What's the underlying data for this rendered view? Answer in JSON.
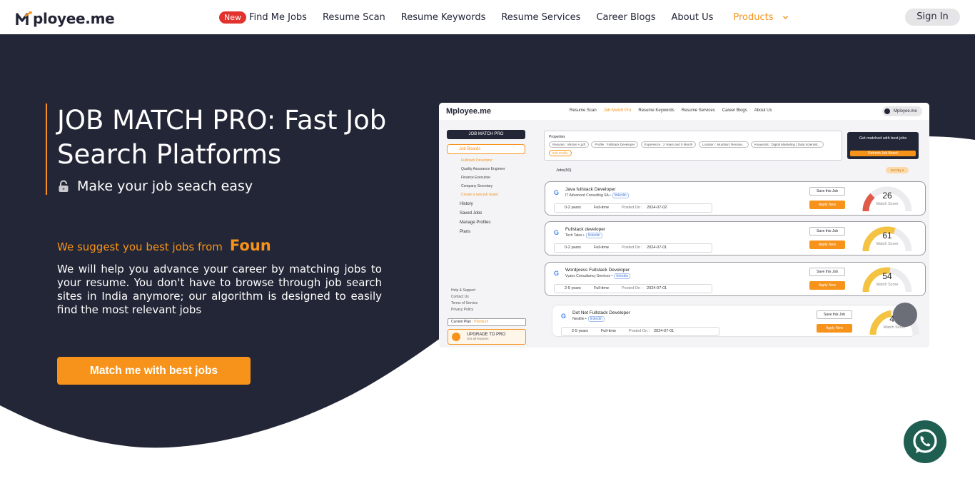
{
  "header": {
    "logo_text": "ployee.me",
    "new_badge": "New",
    "nav": [
      {
        "label": "Find Me Jobs"
      },
      {
        "label": "Resume Scan"
      },
      {
        "label": "Resume Keywords"
      },
      {
        "label": "Resume Services"
      },
      {
        "label": "Career Blogs"
      },
      {
        "label": "About Us"
      }
    ],
    "products_label": "Products",
    "signin_label": "Sign In"
  },
  "hero": {
    "title": "JOB MATCH PRO: Fast Job Search Platforms",
    "subtitle": "Make your job seach easy",
    "suggest_lead": "We suggest you best jobs from",
    "suggest_typed": "Foun",
    "description": "We will help you advance your career by matching jobs to your resume. You don't have to browse through job search sites in India anymore; our algorithm is designed to easily find the most relevant jobs",
    "cta_label": "Match me with best jobs"
  },
  "preview": {
    "logo": "Mployee.me",
    "nav": [
      "Resume Scan",
      "Job Match Pro",
      "Resume Keywords",
      "Resume Services",
      "Career Blogs",
      "About Us"
    ],
    "user": "Mployee.me",
    "sidebar": {
      "title": "JOB MATCH PRO",
      "job_boards": "Job Boards",
      "boards": [
        "Fullstack Developer",
        "Quality Assurance Engineer",
        "Finance Executive",
        "Company Secretary"
      ],
      "create_board": "Create a new job board",
      "menu": [
        "History",
        "Saved Jobs",
        "Manage Profiles",
        "Plans"
      ],
      "help": [
        "Help & Support",
        "Contact Us",
        "Terms of Service",
        "Privacy Policy"
      ],
      "plan_label": "Current Plan :",
      "plan_value": "Premium",
      "upgrade_title": "UPGRADE TO PRO",
      "upgrade_sub": "Get all features"
    },
    "properties": {
      "heading": "Properties",
      "chips": [
        "Resume : Vikram A.pdf",
        "Profile : Fullstack Developer",
        "Experience : 2 Years and 0 Month",
        "Location : Mumbai | Remote...",
        "Keywords : Digital Marketing | Data Scientist...",
        "Edit Profile"
      ]
    },
    "get_matched": "Get matched with best jobs",
    "refresh": "Refresh Job Board",
    "jobs_label": "Jobs(50)",
    "sort_label": "Sort By ▾",
    "jobs": [
      {
        "title": "Java fullstack Developer",
        "company": "IT Advanced Consulting SA •",
        "source": "linkedin",
        "exp": "0-2 years",
        "type": "Full-time",
        "posted": "2024-07-02",
        "score": 26
      },
      {
        "title": "Fullstack developer",
        "company": "Tech Tales •",
        "source": "linkedin",
        "exp": "0-2 years",
        "type": "Full-time",
        "posted": "2024-07-01",
        "score": 61
      },
      {
        "title": "Wordpress Fullstack Developer",
        "company": "Vyans Consultancy Services •",
        "source": "linkedin",
        "exp": "2-5 years",
        "type": "Full-time",
        "posted": "2024-07-01",
        "score": 54
      },
      {
        "title": "Dot Net Fullstack Developer",
        "company": "Nestlite •",
        "source": "linkedin",
        "exp": "2-5 years",
        "type": "Full-time",
        "posted": "2024-07-01",
        "score": 45
      }
    ],
    "save_label": "Save this Job",
    "apply_label": "Apply Now",
    "posted_label": "Posted On :",
    "score_label": "Match Score"
  },
  "colors": {
    "accent": "#f7931a",
    "navy": "#232636",
    "whatsapp": "#1f5f52"
  }
}
